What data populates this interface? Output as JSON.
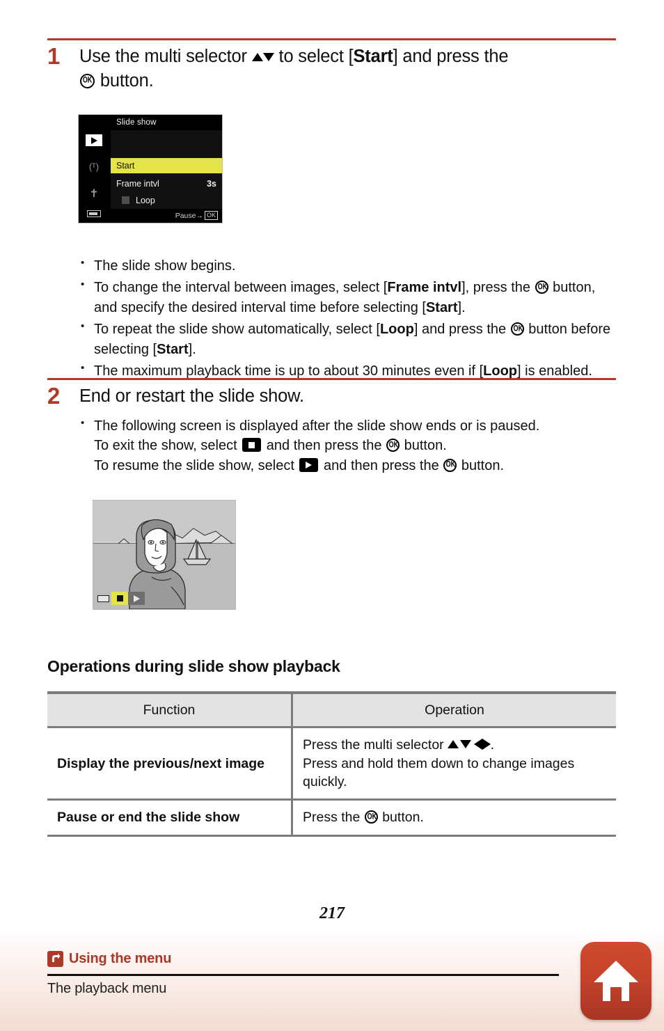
{
  "document": {
    "page_number": "217",
    "accent_color": "#b03a28",
    "highlight_color": "#e4e449"
  },
  "steps": [
    {
      "number": "1",
      "text_before_updown": "Use the multi selector ",
      "text_mid": " to select [",
      "bold_1": "Start",
      "text_after": "] and press the ",
      "text_end": " button."
    },
    {
      "number": "2",
      "title": "End or restart the slide show."
    }
  ],
  "step1": {
    "bullets": {
      "b1": "The slide show begins.",
      "b2_part1": "To change the interval between images, select [",
      "b2_bold1": "Frame intvl",
      "b2_part2": "], press the ",
      "b2_part3": " button, and specify the desired interval time before selecting [",
      "b2_bold2": "Start",
      "b2_part4": "].",
      "b3_part1": "To repeat the slide show automatically, select [",
      "b3_bold1": "Loop",
      "b3_part2": "] and press the ",
      "b3_part3": " button before selecting [",
      "b3_bold2": "Start",
      "b3_part4": "].",
      "b4_part1": "The maximum playback time is up to about 30 minutes even if [",
      "b4_bold1": "Loop",
      "b4_part2": "] is enabled."
    }
  },
  "step2": {
    "bullets": {
      "line1": "The following screen is displayed after the slide show ends or is paused.",
      "line2_part1": "To exit the show, select ",
      "line2_part2": " and then press the ",
      "line2_part3": " button.",
      "line3_part1": "To resume the slide show, select ",
      "line3_part2": " and then press the ",
      "line3_part3": " button."
    }
  },
  "lcd_screen": {
    "title": "Slide show",
    "rows": [
      {
        "label": "Start",
        "value": "",
        "highlighted": true
      },
      {
        "label": "Frame intvl",
        "value": "3s",
        "highlighted": false
      },
      {
        "label": "Loop",
        "value": "",
        "highlighted": false,
        "checkbox": true
      }
    ],
    "footer_hint": "Pause",
    "footer_arrow": "→",
    "footer_ok": "OK",
    "rail_icons": [
      "playback-mode-icon",
      "wireless-network-icon",
      "setup-wrench-icon",
      "battery-icon"
    ]
  },
  "photo_preview": {
    "description": "Woman in front of a seaside landscape with sailboat",
    "controls": [
      "stop-button",
      "play-button"
    ],
    "battery_icon": "battery-icon"
  },
  "operations_section": {
    "heading": "Operations during slide show playback",
    "table": {
      "headers": [
        "Function",
        "Operation"
      ],
      "rows": [
        {
          "function": "Display the previous/next image",
          "operation_line1_prefix": "Press the multi selector ",
          "operation_line1_suffix": ".",
          "operation_line2": "Press and hold them down to change images quickly."
        },
        {
          "function": "Pause or end the slide show",
          "operation_line1_prefix": "Press the ",
          "operation_line1_suffix": " button.",
          "operation_line2": ""
        }
      ]
    }
  },
  "footer": {
    "breadcrumb": "Using the menu",
    "subtitle": "The playback menu",
    "badge_icon": "return-arrow-icon",
    "home_icon": "home-icon"
  }
}
